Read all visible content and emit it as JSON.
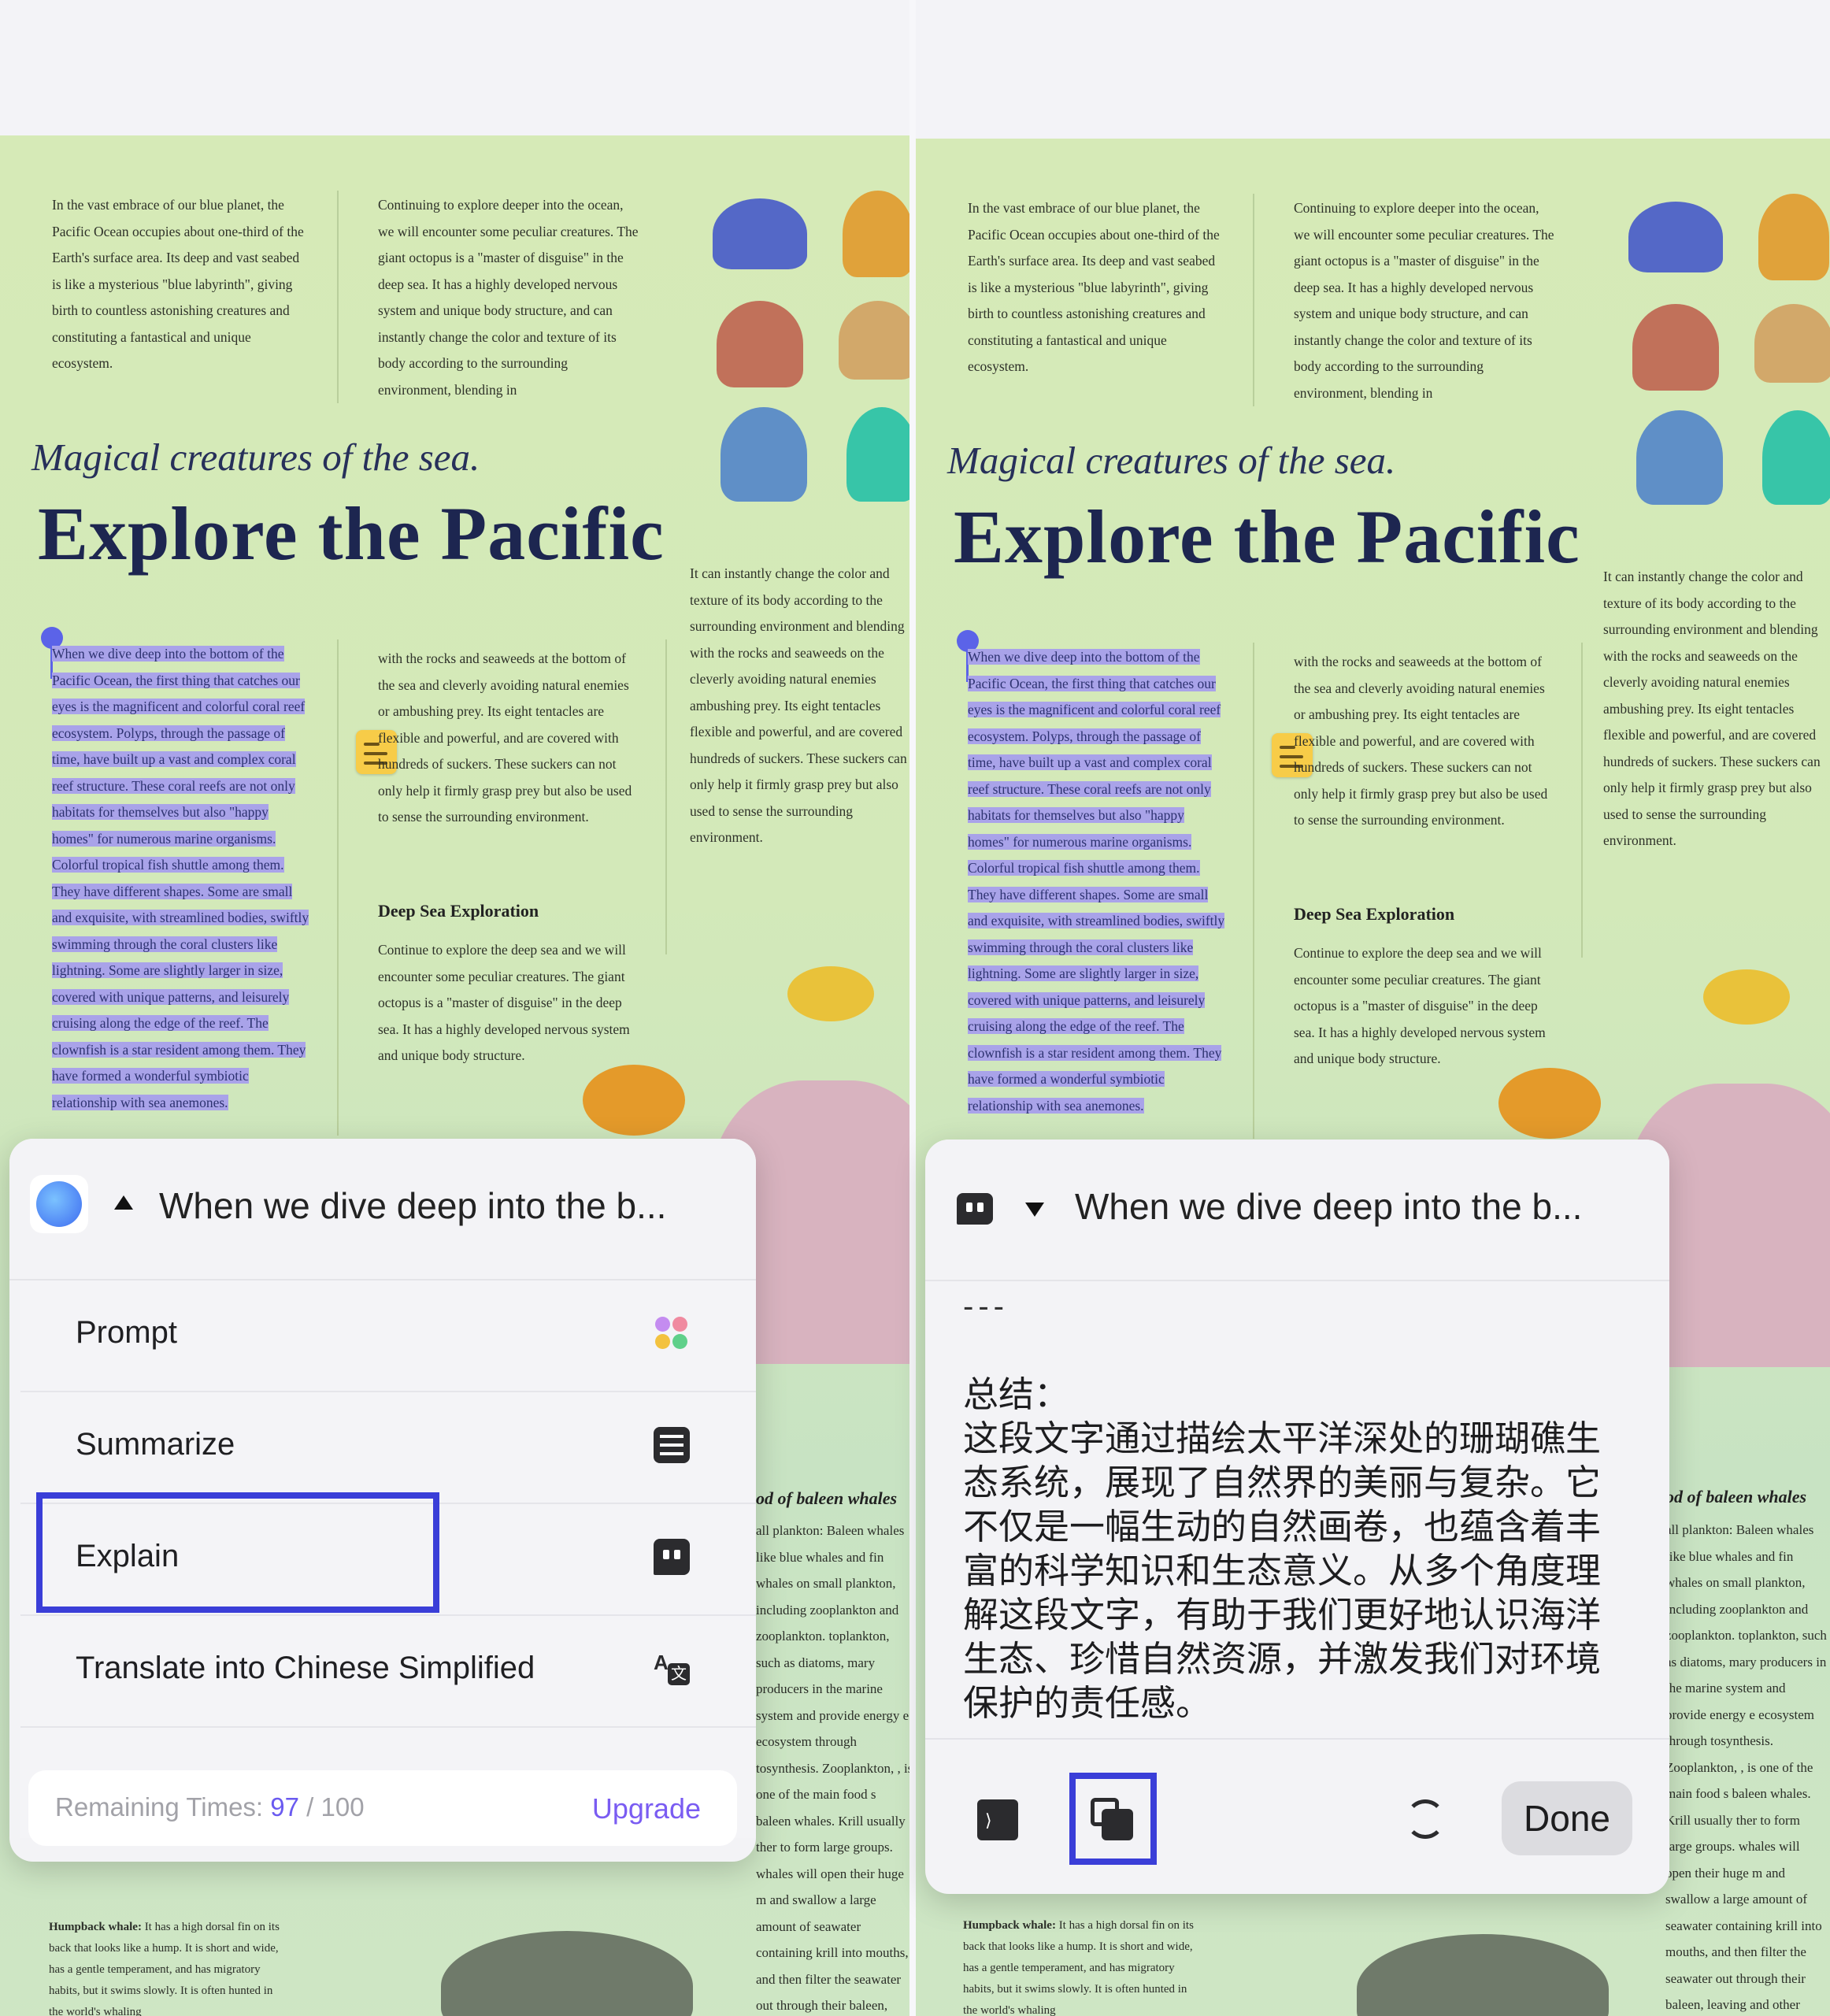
{
  "document": {
    "intro_col1": "In the vast embrace of our blue planet, the Pacific Ocean occupies about one-third of the Earth's surface area. Its deep and vast seabed is like a mysterious \"blue labyrinth\", giving birth to countless astonishing creatures and constituting a fantastical and unique ecosystem.",
    "intro_col2": "Continuing to explore deeper into the ocean, we will encounter some peculiar creatures. The giant octopus is a \"master of disguise\" in the deep sea. It has a highly developed nervous system and unique body structure, and can instantly change the color and texture of its body according to the surrounding environment, blending in",
    "subtitle": "Magical creatures of the sea.",
    "title": "Explore the Pacific",
    "highlighted_paragraph": "When we dive deep into the bottom of the Pacific Ocean, the first thing that catches our eyes is the magnificent and colorful coral reef ecosystem. Polyps, through the passage of time, have built up a vast and complex coral reef structure. These coral reefs are not only habitats for themselves but also \"happy homes\" for numerous marine organisms. Colorful tropical fish shuttle among them. They have different shapes. Some are small and exquisite, with streamlined bodies, swiftly swimming through the coral clusters like lightning. Some are slightly larger in size, covered with unique patterns, and leisurely cruising along the edge of the reef. The clownfish is a star resident among them. They have formed a wonderful symbiotic relationship with sea anemones.",
    "mid_col": "with the rocks and seaweeds at the bottom of the sea and cleverly avoiding natural enemies or ambushing prey. Its eight tentacles are flexible and powerful, and are covered with hundreds of suckers. These suckers can not only help it firmly grasp prey but also be used to sense the surrounding environment.",
    "right_col": "It can instantly change the color and texture of its body according to the surrounding environment and blending with the rocks and seaweeds on the cleverly avoiding natural enemies ambushing prey. Its eight tentacles flexible and powerful, and are covered hundreds of suckers. These suckers can only help it firmly grasp prey but also used to sense the surrounding environment.",
    "deep_sea_heading": "Deep Sea Exploration",
    "deep_sea_text": "Continue to explore the deep sea and we will encounter some peculiar creatures. The giant octopus is a \"master of disguise\" in the deep sea. It has a highly developed nervous system and unique body structure.",
    "baleen_heading": "od of baleen whales",
    "baleen_text": "all plankton: Baleen whales like blue whales and fin whales on small plankton, including zooplankton and zooplankton. toplankton, such as diatoms, mary producers in the marine system and provide energy e ecosystem through tosynthesis. Zooplankton, , is one of the main food s baleen whales. Krill usually ther to form large groups. whales will open their huge m and swallow a large amount of seawater containing krill into mouths, and then filter the seawater out through their baleen, leaving and other food in their mouths",
    "humpback_label": "Humpback whale:",
    "humpback_text": "It has a high dorsal fin on its back that looks like a hump. It is short and wide, has a gentle temperament, and has migratory habits, but it swims slowly. It is often hunted in the world's whaling"
  },
  "left_panel": {
    "header_text": "When we dive deep into the b...",
    "menu": [
      {
        "label": "Prompt",
        "icon": "prompt-dots-icon"
      },
      {
        "label": "Summarize",
        "icon": "list-icon"
      },
      {
        "label": "Explain",
        "icon": "explain-bubble-icon"
      },
      {
        "label": "Translate into Chinese Simplified",
        "icon": "translate-icon"
      }
    ],
    "remaining_label": "Remaining Times:",
    "remaining_used": "97",
    "remaining_sep": " / ",
    "remaining_total": "100",
    "upgrade": "Upgrade"
  },
  "right_panel": {
    "header_text": "When we dive deep into the b...",
    "separator": "---",
    "result_heading": "总结：",
    "result_body": "这段文字通过描绘太平洋深处的珊瑚礁生态系统，展现了自然界的美丽与复杂。它不仅是一幅生动的自然画卷，也蕴含着丰富的科学知识和生态意义。从多个角度理解这段文字，有助于我们更好地认识海洋生态、珍惜自然资源，并激发我们对环境保护的责任感。",
    "done": "Done"
  },
  "colors": {
    "accent": "#3a3ed8",
    "highlight": "#a9a3e9",
    "upgrade": "#7a5cf2"
  }
}
